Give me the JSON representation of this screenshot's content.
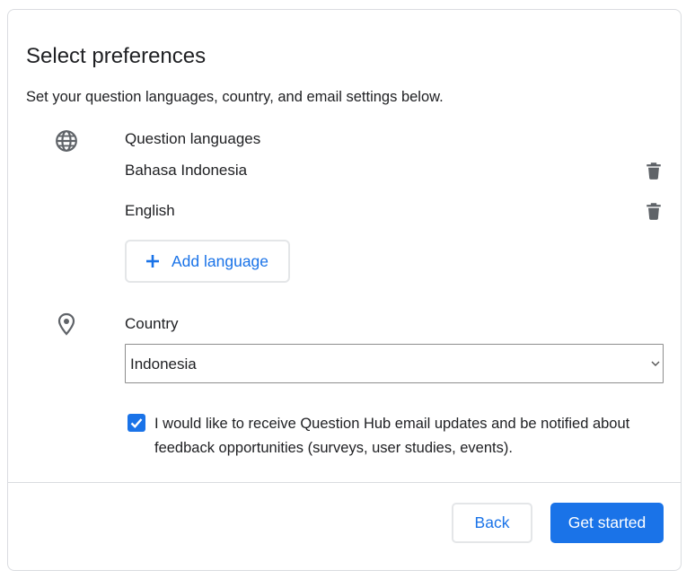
{
  "header": {
    "title": "Select preferences",
    "subtitle": "Set your question languages, country, and email settings below."
  },
  "languages": {
    "label": "Question languages",
    "icon": "globe-icon",
    "items": [
      {
        "name": "Bahasa Indonesia",
        "delete_icon": "trash-icon"
      },
      {
        "name": "English",
        "delete_icon": "trash-icon"
      }
    ],
    "add_button_label": "Add language"
  },
  "country": {
    "label": "Country",
    "icon": "location-pin-icon",
    "selected": "Indonesia"
  },
  "email_opt_in": {
    "checked": true,
    "label": "I would like to receive Question Hub email updates and be notified about feedback opportunities (surveys, user studies, events)."
  },
  "footer": {
    "back_label": "Back",
    "start_label": "Get started"
  },
  "colors": {
    "accent": "#1a73e8",
    "text": "#202124",
    "icon_gray": "#5f6368",
    "border": "#dadce0"
  }
}
